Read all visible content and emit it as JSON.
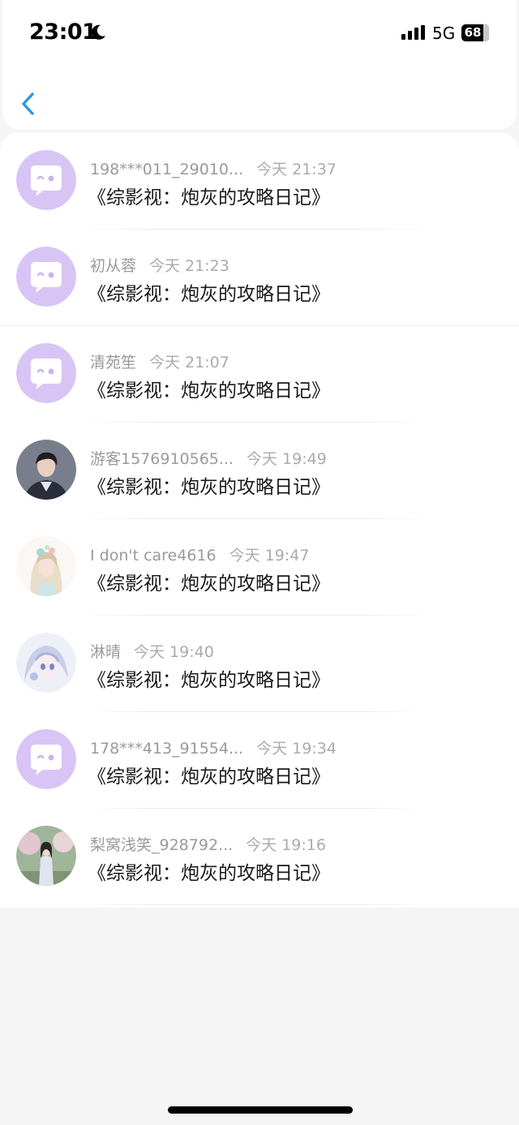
{
  "status_bar": {
    "time": "23:01",
    "network": "5G",
    "battery": "68"
  },
  "colors": {
    "accent": "#2b9be0",
    "default_avatar": "#d8c5f5"
  },
  "messages": [
    {
      "user": "198***011_29010...",
      "time": "今天 21:37",
      "title": "《综影视：炮灰的攻略日记》",
      "avatar": "default-chat-icon"
    },
    {
      "user": "初从蓉",
      "time": "今天 21:23",
      "title": "《综影视：炮灰的攻略日记》",
      "avatar": "default-chat-icon"
    },
    {
      "user": "清苑笙",
      "time": "今天 21:07",
      "title": "《综影视：炮灰的攻略日记》",
      "avatar": "default-chat-icon"
    },
    {
      "user": "游客1576910565...",
      "time": "今天 19:49",
      "title": "《综影视：炮灰的攻略日记》",
      "avatar": "photo-man"
    },
    {
      "user": "I don't care4616",
      "time": "今天 19:47",
      "title": "《综影视：炮灰的攻略日记》",
      "avatar": "anime-girl-flowers"
    },
    {
      "user": "淋晴",
      "time": "今天 19:40",
      "title": "《综影视：炮灰的攻略日记》",
      "avatar": "anime-girl-blue"
    },
    {
      "user": "178***413_91554...",
      "time": "今天 19:34",
      "title": "《综影视：炮灰的攻略日记》",
      "avatar": "default-chat-icon"
    },
    {
      "user": "梨窝浅笑_928792...",
      "time": "今天 19:16",
      "title": "《综影视：炮灰的攻略日记》",
      "avatar": "photo-girl-trees"
    }
  ]
}
